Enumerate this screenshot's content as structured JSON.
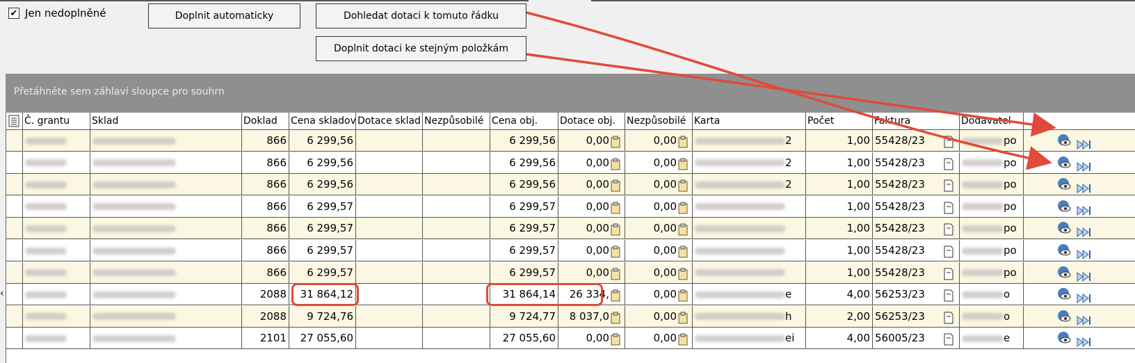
{
  "toolbar": {
    "checkbox_label": "Jen nedoplněné",
    "checkbox_checked": true,
    "btn_auto": "Doplnit automaticky",
    "btn_find": "Dohledat dotaci k tomuto řádku",
    "btn_same": "Doplnit dotaci ke stejným položkám"
  },
  "grid": {
    "group_hint": "Přetáhněte sem záhlaví sloupce pro souhrn",
    "columns": [
      "Č. grantu",
      "Sklad",
      "Doklad",
      "Cena skladová",
      "Dotace sklad",
      "Nezpůsobilé",
      "Cena obj.",
      "Dotace obj.",
      "Nezpůsobilé",
      "Karta",
      "Počet",
      "Faktura",
      "Dodavatel"
    ],
    "rows": [
      {
        "doklad": "866",
        "cena_skl": "6 299,56",
        "cena_obj": "6 299,56",
        "dotace_obj": "0,00",
        "nezp": "0,00",
        "karta_suffix": "2",
        "pocet": "1,00",
        "faktura": "55428/23",
        "dodavatel_suffix": "po"
      },
      {
        "doklad": "866",
        "cena_skl": "6 299,56",
        "cena_obj": "6 299,56",
        "dotace_obj": "0,00",
        "nezp": "0,00",
        "karta_suffix": "2",
        "pocet": "1,00",
        "faktura": "55428/23",
        "dodavatel_suffix": "po"
      },
      {
        "doklad": "866",
        "cena_skl": "6 299,56",
        "cena_obj": "6 299,56",
        "dotace_obj": "0,00",
        "nezp": "0,00",
        "karta_suffix": "2",
        "pocet": "1,00",
        "faktura": "55428/23",
        "dodavatel_suffix": "po"
      },
      {
        "doklad": "866",
        "cena_skl": "6 299,57",
        "cena_obj": "6 299,57",
        "dotace_obj": "0,00",
        "nezp": "0,00",
        "karta_suffix": "",
        "pocet": "1,00",
        "faktura": "55428/23",
        "dodavatel_suffix": "po"
      },
      {
        "doklad": "866",
        "cena_skl": "6 299,57",
        "cena_obj": "6 299,57",
        "dotace_obj": "0,00",
        "nezp": "0,00",
        "karta_suffix": "",
        "pocet": "1,00",
        "faktura": "55428/23",
        "dodavatel_suffix": "po"
      },
      {
        "doklad": "866",
        "cena_skl": "6 299,57",
        "cena_obj": "6 299,57",
        "dotace_obj": "0,00",
        "nezp": "0,00",
        "karta_suffix": "",
        "pocet": "1,00",
        "faktura": "55428/23",
        "dodavatel_suffix": "po"
      },
      {
        "doklad": "866",
        "cena_skl": "6 299,57",
        "cena_obj": "6 299,57",
        "dotace_obj": "0,00",
        "nezp": "0,00",
        "karta_suffix": "",
        "pocet": "1,00",
        "faktura": "55428/23",
        "dodavatel_suffix": "po"
      },
      {
        "doklad": "2088",
        "cena_skl": "31 864,12",
        "cena_obj": "31 864,14",
        "dotace_obj": "26 334,",
        "nezp": "0,00",
        "karta_suffix": "e",
        "pocet": "4,00",
        "faktura": "56253/23",
        "dodavatel_suffix": "o"
      },
      {
        "doklad": "2088",
        "cena_skl": "9 724,76",
        "cena_obj": "9 724,77",
        "dotace_obj": "8 037,0",
        "nezp": "0,00",
        "karta_suffix": "h",
        "pocet": "2,00",
        "faktura": "56253/23",
        "dodavatel_suffix": "o"
      },
      {
        "doklad": "2101",
        "cena_skl": "27 055,60",
        "cena_obj": "27 055,60",
        "dotace_obj": "0,00",
        "nezp": "0,00",
        "karta_suffix": "ei",
        "pocet": "4,00",
        "faktura": "56005/23",
        "dodavatel_suffix": "e"
      }
    ]
  },
  "colors": {
    "annotation": "#e04a3a",
    "odd_row": "#fbf7e2",
    "group_panel": "#8f8f8f"
  },
  "icons": [
    "clipboard-icon",
    "document-icon",
    "view-icon",
    "next-icon"
  ]
}
